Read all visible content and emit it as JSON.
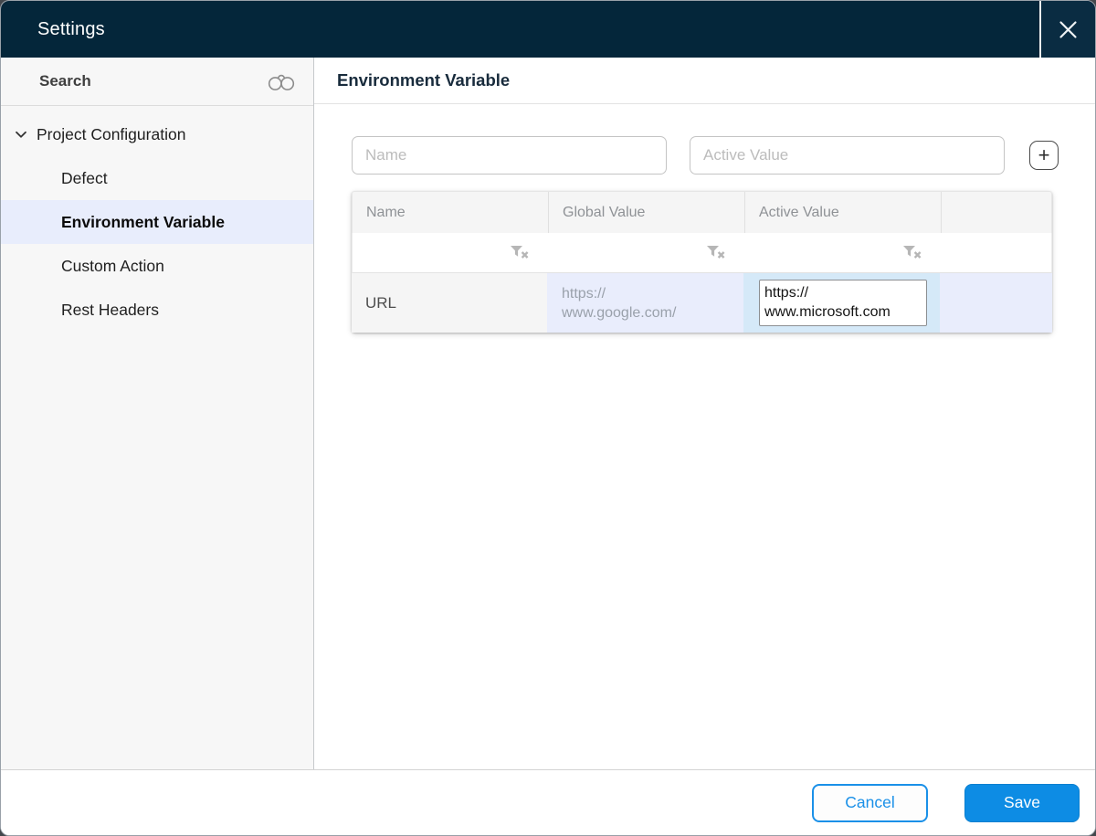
{
  "window": {
    "title": "Settings"
  },
  "sidebar": {
    "search": {
      "label": "Search",
      "icon": "binoculars"
    },
    "tree": {
      "parent": {
        "label": "Project Configuration",
        "state": "expanded",
        "icon": "chevron-down"
      },
      "items": [
        {
          "label": "Defect",
          "selected": false
        },
        {
          "label": "Environment Variable",
          "selected": true
        },
        {
          "label": "Custom Action",
          "selected": false
        },
        {
          "label": "Rest Headers",
          "selected": false
        }
      ]
    }
  },
  "main": {
    "heading": "Environment Variable",
    "add_form": {
      "name_placeholder": "Name",
      "active_value_placeholder": "Active Value",
      "add_button_label": "+"
    },
    "table": {
      "columns": [
        "Name",
        "Global Value",
        "Active Value",
        ""
      ],
      "filter_icon": "funnel-with-x",
      "rows": [
        {
          "name": "URL",
          "global_value": "https://\nwww.google.com/",
          "active_value": "https://\nwww.microsoft.com",
          "active_value_editing": true
        }
      ]
    }
  },
  "footer": {
    "cancel_label": "Cancel",
    "save_label": "Save"
  },
  "colors": {
    "titlebar": "#04263a",
    "accent": "#0d8ce4",
    "accent-border": "#1a90e8",
    "selection": "#e8edfc",
    "cell-highlight": "#d5e9f8",
    "cell-tint": "#e9edfc"
  }
}
